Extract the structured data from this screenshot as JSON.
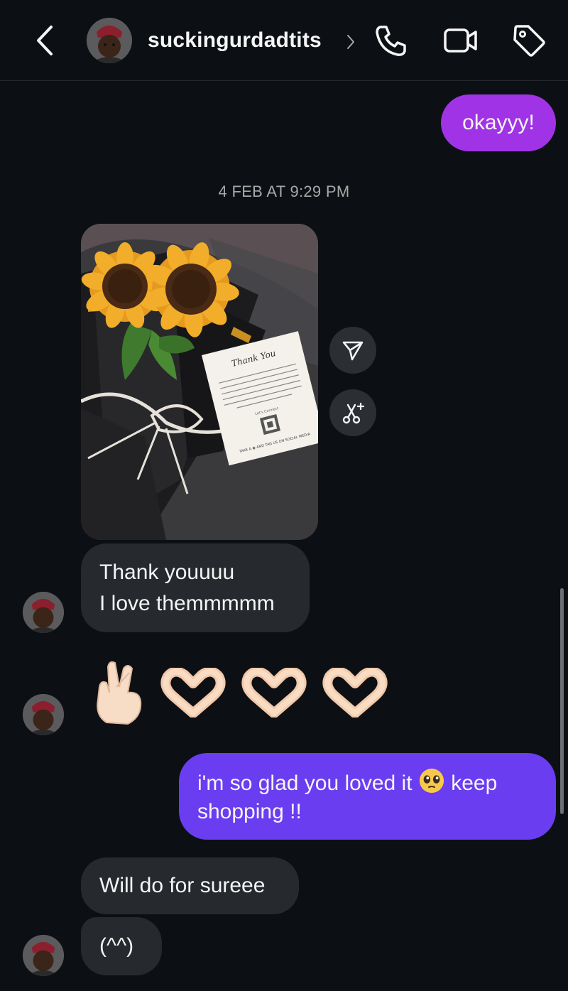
{
  "header": {
    "username": "suckingurdadtits",
    "icons": [
      "back-icon",
      "chevron-right-icon",
      "phone-icon",
      "video-icon",
      "tag-icon"
    ]
  },
  "messages": {
    "outgoing_1": "okayyy!",
    "timestamp": "4 FEB AT 9:29 PM",
    "photo_card": {
      "title": "Thank You",
      "body": "For choosing our cozy and colorful crochet products! We hope you enjoy them as much as we enjoyed making them. Please share your feedback with us and let us know how we can serve you better in the future.",
      "signoff": "Let's Connect",
      "footer": "TAKE A ◉ AND TAG US ON SOCIAL MEDIA"
    },
    "photo_actions": [
      "send-icon",
      "remix-icon"
    ],
    "incoming_1_line1": "Thank youuuu",
    "incoming_1_line2": "I love themmmmm",
    "emoji_reaction": [
      "crossed-fingers-emoji",
      "heart-hands-emoji",
      "heart-hands-emoji",
      "heart-hands-emoji"
    ],
    "outgoing_2_part1": "i'm so glad you loved it",
    "outgoing_2_emoji": "pleading-face-emoji",
    "outgoing_2_part2": "keep",
    "outgoing_2_line2": "shopping !!",
    "incoming_2": "Will do for sureee",
    "incoming_3": "(^^)"
  },
  "colors": {
    "background": "#0c1014",
    "outgoing_purple": "#a133e6",
    "outgoing_violet": "#6a3df0",
    "incoming_bubble": "#262a2f",
    "timestamp": "#a8a8a8"
  }
}
